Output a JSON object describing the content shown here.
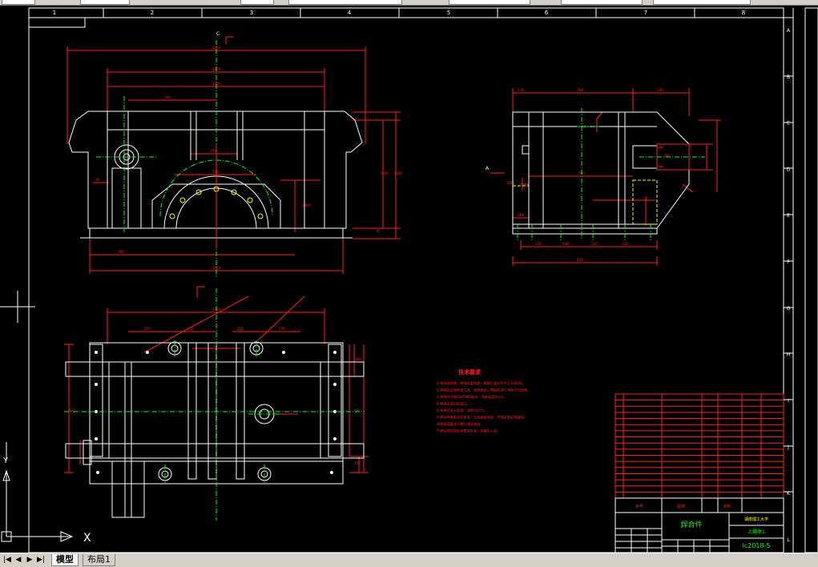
{
  "drawing": {
    "border_columns": [
      "1",
      "2",
      "3",
      "4",
      "5",
      "6",
      "7",
      "8"
    ],
    "border_rows": [
      "A",
      "B",
      "C",
      "D",
      "E",
      "F",
      "G",
      "H",
      "I",
      "J",
      "K",
      "L"
    ],
    "section_marker": "C",
    "view_marker": "A",
    "front_view_dims": [
      "1300",
      "1100",
      "540",
      "370",
      "510",
      "760",
      "1400",
      "1400",
      "1400",
      "1400",
      "1400",
      "40",
      "45"
    ],
    "side_view_dims": [
      "121",
      "404",
      "335",
      "485",
      "5541",
      "281",
      "221",
      "188",
      "220",
      "220",
      "951",
      "400"
    ],
    "plan_view_dims": [
      "1340",
      "220",
      "315",
      "250",
      "270",
      "150",
      "450",
      "400",
      "1400",
      "350"
    ],
    "tech_req_title": "技术要求",
    "tech_req_lines": [
      "1.焊接前除锈，焊缝高度按图，焊接后变形不大于1/1000。",
      "2.焊接后去除焊渣飞溅，清理表面，焊接前进行消除应力处理。",
      "3.焊接尺寸按GB/T985要求，焊缝高度5mm。",
      "4.焊接完成后机加工。",
      "5.焊接后退火处理，消除内应力。",
      "6.焊接件表面涂防锈漆，去除表面毛刺，不得有裂纹等缺陷。",
      "  焊件表面要求平整光滑无缺陷。",
      "7.焊后检验按技术要求检查，合格后入库。"
    ]
  },
  "title_block": {
    "assembly_name": "焊合件",
    "school": "湖南理工大学",
    "part_name": "上箱体1",
    "drawing_no": "lc2018-5",
    "label_no": "序号",
    "label_name": "名称",
    "label_material": "材料"
  },
  "layout_tabs": {
    "nav_first": "|◀",
    "nav_prev": "◀",
    "nav_next": "▶",
    "nav_last": "▶|",
    "tabs": [
      "模型",
      "布局1"
    ],
    "active_index": 0
  },
  "ucs": {
    "x_label": "X",
    "y_label": "Y"
  },
  "colors": {
    "background": "#000000",
    "frame": "#ffffff",
    "dimension": "#ff2020",
    "outline": "#ffffff",
    "centerline": "#00ff00",
    "hidden": "#ffff00",
    "tab_bar": "#d4d0c8"
  }
}
